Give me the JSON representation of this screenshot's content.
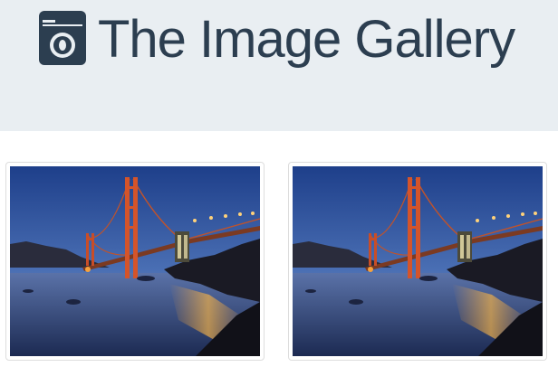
{
  "header": {
    "title": "The Image Gallery",
    "logo_icon": "camera-icon",
    "background": "#e9eef2",
    "title_color": "#2c3e50"
  },
  "gallery": {
    "items": [
      {
        "image": "golden-gate-bridge-dusk-photo"
      },
      {
        "image": "golden-gate-bridge-dusk-photo"
      }
    ]
  }
}
